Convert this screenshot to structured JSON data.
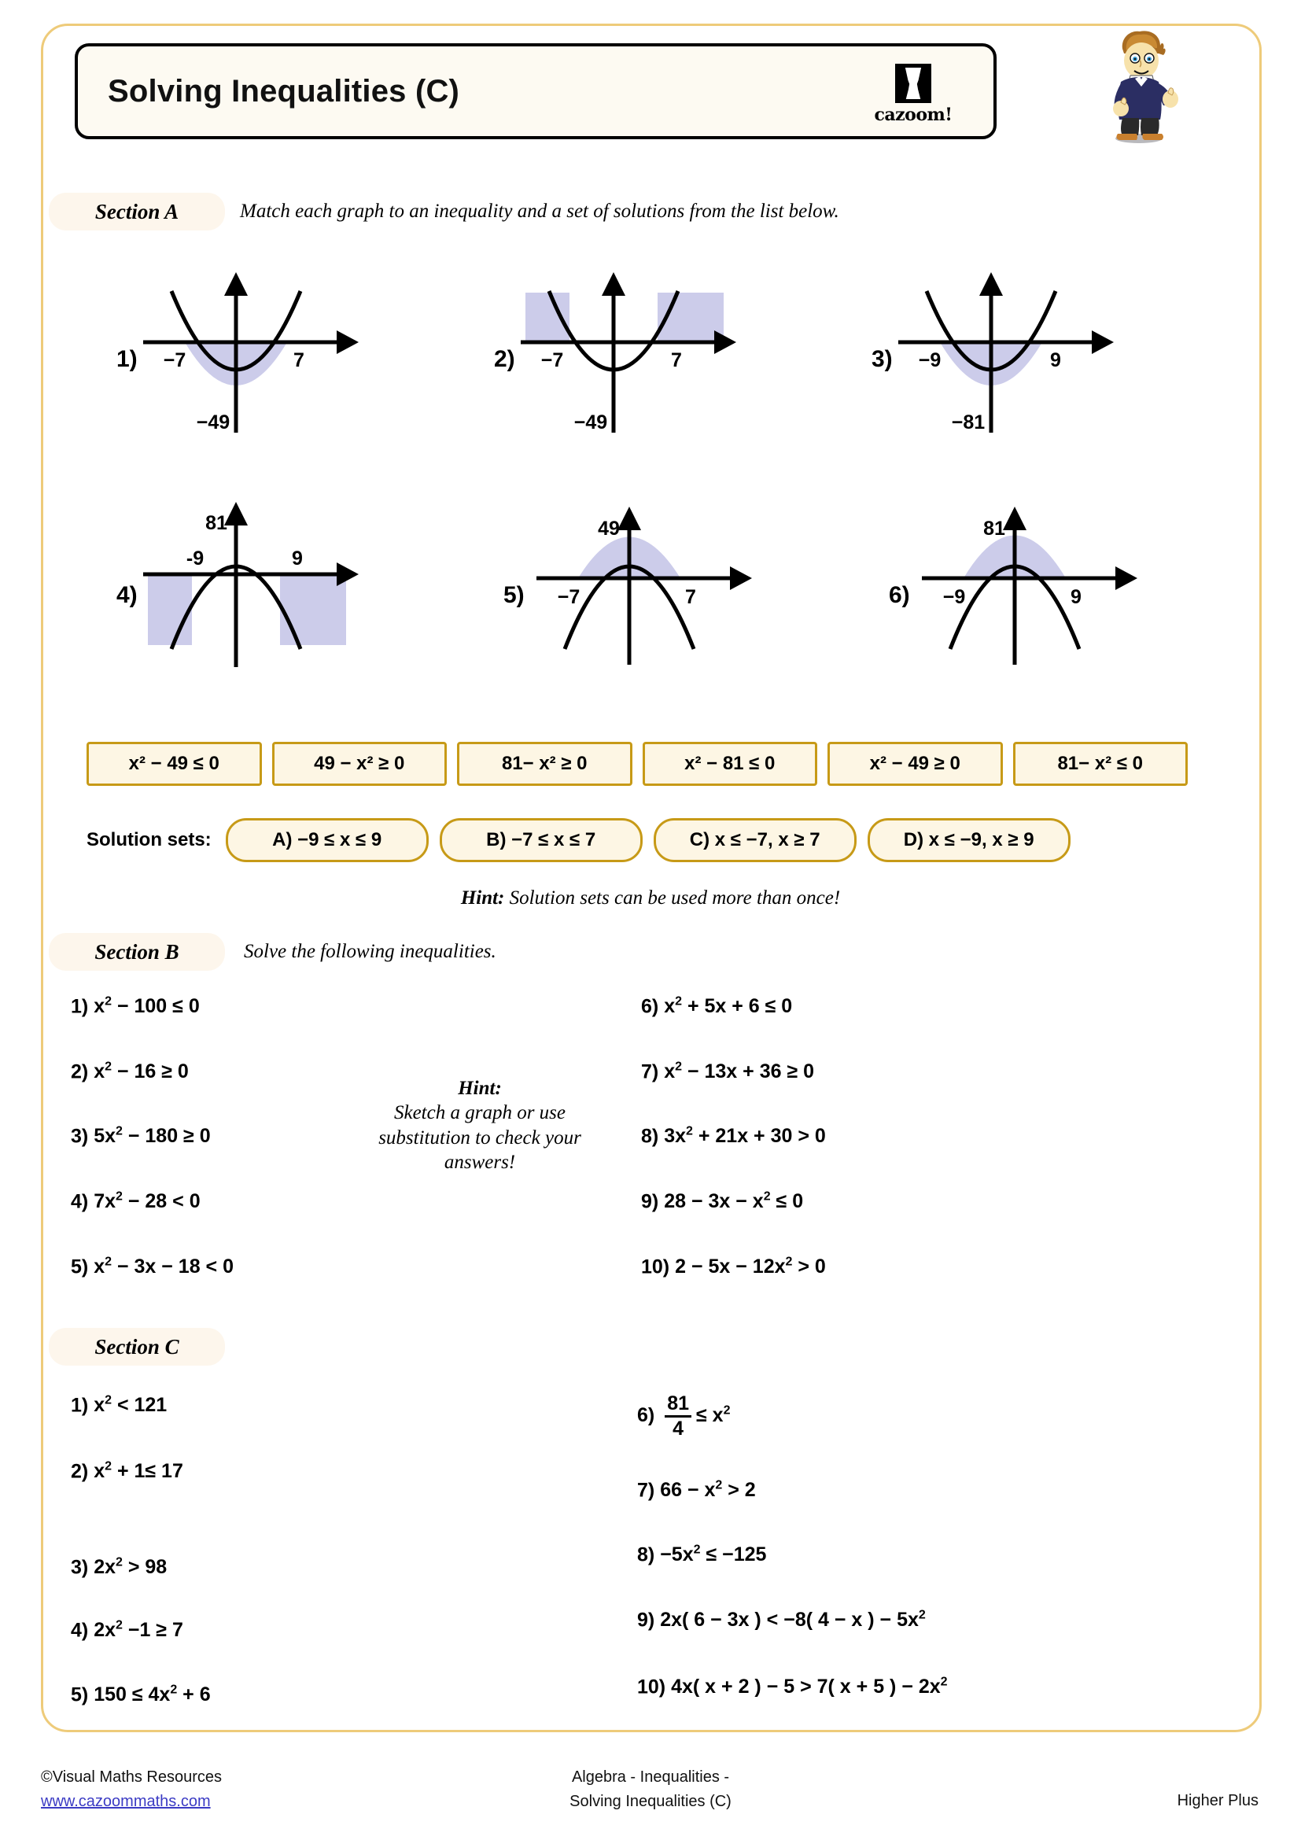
{
  "header": {
    "title": "Solving Inequalities (C)",
    "logo_text": "cazoom!",
    "logo_icon": "cazoom-cup-logo",
    "mascot": "boy-mascot-illustration"
  },
  "sections": {
    "a": {
      "label": "Section A",
      "instruction": "Match each graph to an inequality and a set of solutions from the list below."
    },
    "b": {
      "label": "Section B",
      "instruction": "Solve the following inequalities."
    },
    "c": {
      "label": "Section C",
      "instruction": ""
    }
  },
  "chart_data": [
    {
      "id": "1",
      "type": "line",
      "title": "1)",
      "orientation": "up",
      "roots": [
        -7,
        7
      ],
      "root_labels": [
        "−7",
        "7"
      ],
      "vertex": -49,
      "vertex_label": "−49",
      "shading": "inside",
      "xlabel": "",
      "ylabel": ""
    },
    {
      "id": "2",
      "type": "line",
      "title": "2)",
      "orientation": "up",
      "roots": [
        -7,
        7
      ],
      "root_labels": [
        "−7",
        "7"
      ],
      "vertex": -49,
      "vertex_label": "−49",
      "shading": "outside",
      "xlabel": "",
      "ylabel": ""
    },
    {
      "id": "3",
      "type": "line",
      "title": "3)",
      "orientation": "up",
      "roots": [
        -9,
        9
      ],
      "root_labels": [
        "−9",
        "9"
      ],
      "vertex": -81,
      "vertex_label": "−81",
      "shading": "inside",
      "xlabel": "",
      "ylabel": ""
    },
    {
      "id": "4",
      "type": "line",
      "title": "4)",
      "orientation": "down",
      "roots": [
        -9,
        9
      ],
      "root_labels": [
        "-9",
        "9"
      ],
      "vertex": 81,
      "vertex_label": "81",
      "shading": "outside",
      "xlabel": "",
      "ylabel": ""
    },
    {
      "id": "5",
      "type": "line",
      "title": "5)",
      "orientation": "down",
      "roots": [
        -7,
        7
      ],
      "root_labels": [
        "−7",
        "7"
      ],
      "vertex": 49,
      "vertex_label": "49",
      "shading": "inside",
      "xlabel": "",
      "ylabel": ""
    },
    {
      "id": "6",
      "type": "line",
      "title": "6)",
      "orientation": "down",
      "roots": [
        -9,
        9
      ],
      "root_labels": [
        "−9",
        "9"
      ],
      "vertex": 81,
      "vertex_label": "81",
      "shading": "inside",
      "xlabel": "",
      "ylabel": ""
    }
  ],
  "inequality_options": [
    "x² − 49 ≤ 0",
    "49 − x² ≥ 0",
    "81− x² ≥ 0",
    "x² − 81 ≤ 0",
    "x² − 49 ≥ 0",
    "81− x² ≤ 0"
  ],
  "solution_sets": {
    "label": "Solution sets:",
    "options": [
      "A) −9 ≤ x ≤ 9",
      "B) −7 ≤ x ≤ 7",
      "C) x ≤ −7, x ≥ 7",
      "D) x ≤ −9, x ≥ 9"
    ]
  },
  "hint_a": {
    "bold": "Hint:",
    "text": " Solution sets can be used more than once!"
  },
  "hint_b": {
    "title": "Hint:",
    "line1": "Sketch a graph or use",
    "line2": "substitution to check your",
    "line3": "answers!"
  },
  "section_b_questions": {
    "left": [
      {
        "num": "1)",
        "expr_html": "x<sup>2</sup> − 100 ≤ 0"
      },
      {
        "num": "2)",
        "expr_html": "x<sup>2</sup> − 16 ≥ 0"
      },
      {
        "num": "3)",
        "expr_html": "5x<sup>2</sup> − 180 ≥ 0"
      },
      {
        "num": "4)",
        "expr_html": "7x<sup>2</sup> − 28 < 0"
      },
      {
        "num": "5)",
        "expr_html": "x<sup>2</sup> − 3x − 18 < 0"
      }
    ],
    "right": [
      {
        "num": "6)",
        "expr_html": "x<sup>2</sup> + 5x + 6 ≤ 0"
      },
      {
        "num": "7)",
        "expr_html": "x<sup>2</sup> − 13x + 36 ≥ 0"
      },
      {
        "num": "8)",
        "expr_html": "3x<sup>2</sup> + 21x + 30 > 0"
      },
      {
        "num": "9)",
        "expr_html": "28 − 3x − x<sup>2</sup> ≤ 0"
      },
      {
        "num": "10)",
        "expr_html": "2 − 5x − 12x<sup>2</sup> > 0"
      }
    ]
  },
  "section_c_questions": {
    "left": [
      {
        "num": "1)",
        "expr_html": "x<sup>2</sup> < 121"
      },
      {
        "num": "2)",
        "expr_html": "x<sup>2</sup> + 1≤ 17"
      },
      {
        "num": "3)",
        "expr_html": "2x<sup>2</sup> > 98"
      },
      {
        "num": "4)",
        "expr_html": "2x<sup>2</sup> −1 ≥ 7"
      },
      {
        "num": "5)",
        "expr_html": "150 ≤ 4x<sup>2</sup> + 6"
      }
    ],
    "right": [
      {
        "num": "6)",
        "expr_html": "<span class=\"frac\"><span class=\"num\">81</span><span class=\"bar\"></span><span class=\"den\">4</span></span>≤ x<sup>2</sup>"
      },
      {
        "num": "7)",
        "expr_html": "66 − x<sup>2</sup> > 2"
      },
      {
        "num": "8)",
        "expr_html": "−5x<sup>2</sup> ≤ −125"
      },
      {
        "num": "9)",
        "expr_html": "2x( 6 − 3x ) < −8( 4 − x ) − 5x<sup>2</sup>"
      },
      {
        "num": "10)",
        "expr_html": "4x( x + 2 ) − 5 > 7( x + 5 ) − 2x<sup>2</sup>"
      }
    ]
  },
  "footer": {
    "copyright": "©Visual Maths Resources",
    "website": "www.cazoommaths.com",
    "center_line1": "Algebra - Inequalities -",
    "center_line2": "Solving Inequalities (C)",
    "level": "Higher Plus"
  },
  "colors": {
    "frame": "#eecb7a",
    "pill_bg": "#fdf6ec",
    "option_border": "#c79a17",
    "option_bg": "#fdf6e4",
    "shade": "#ccccea"
  }
}
